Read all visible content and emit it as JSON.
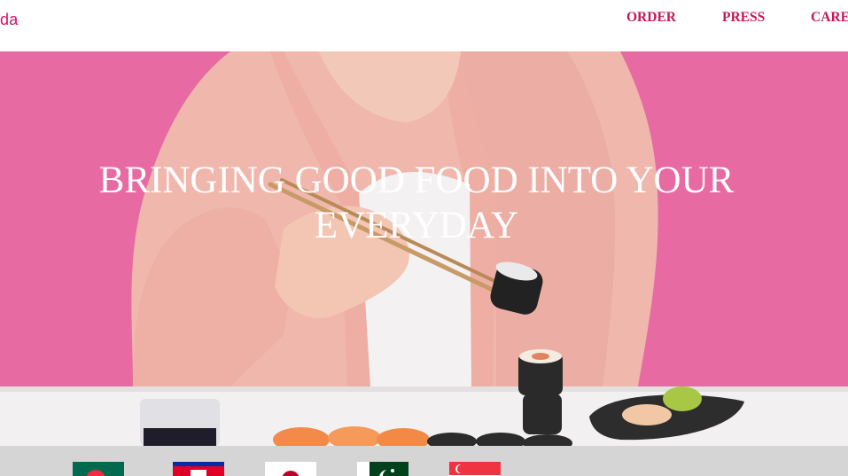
{
  "header": {
    "logo_text": "da",
    "nav": [
      {
        "label": "ORDER"
      },
      {
        "label": "PRESS"
      },
      {
        "label": "CARE"
      }
    ]
  },
  "hero": {
    "title": "BRINGING GOOD FOOD INTO YOUR EVERYDAY",
    "background_color": "#e76aa3"
  },
  "countries": {
    "flags": [
      {
        "name": "Bangladesh",
        "icon": "bangladesh-flag-icon"
      },
      {
        "name": "Cambodia",
        "icon": "cambodia-flag-icon"
      },
      {
        "name": "Japan",
        "icon": "japan-flag-icon"
      },
      {
        "name": "Pakistan",
        "icon": "pakistan-flag-icon"
      },
      {
        "name": "Singapore",
        "icon": "singapore-flag-icon"
      }
    ]
  },
  "colors": {
    "brand": "#d70f64",
    "nav_text": "#c2185b",
    "hero_bg": "#e76aa3",
    "strip_bg": "#d5d5d5"
  }
}
